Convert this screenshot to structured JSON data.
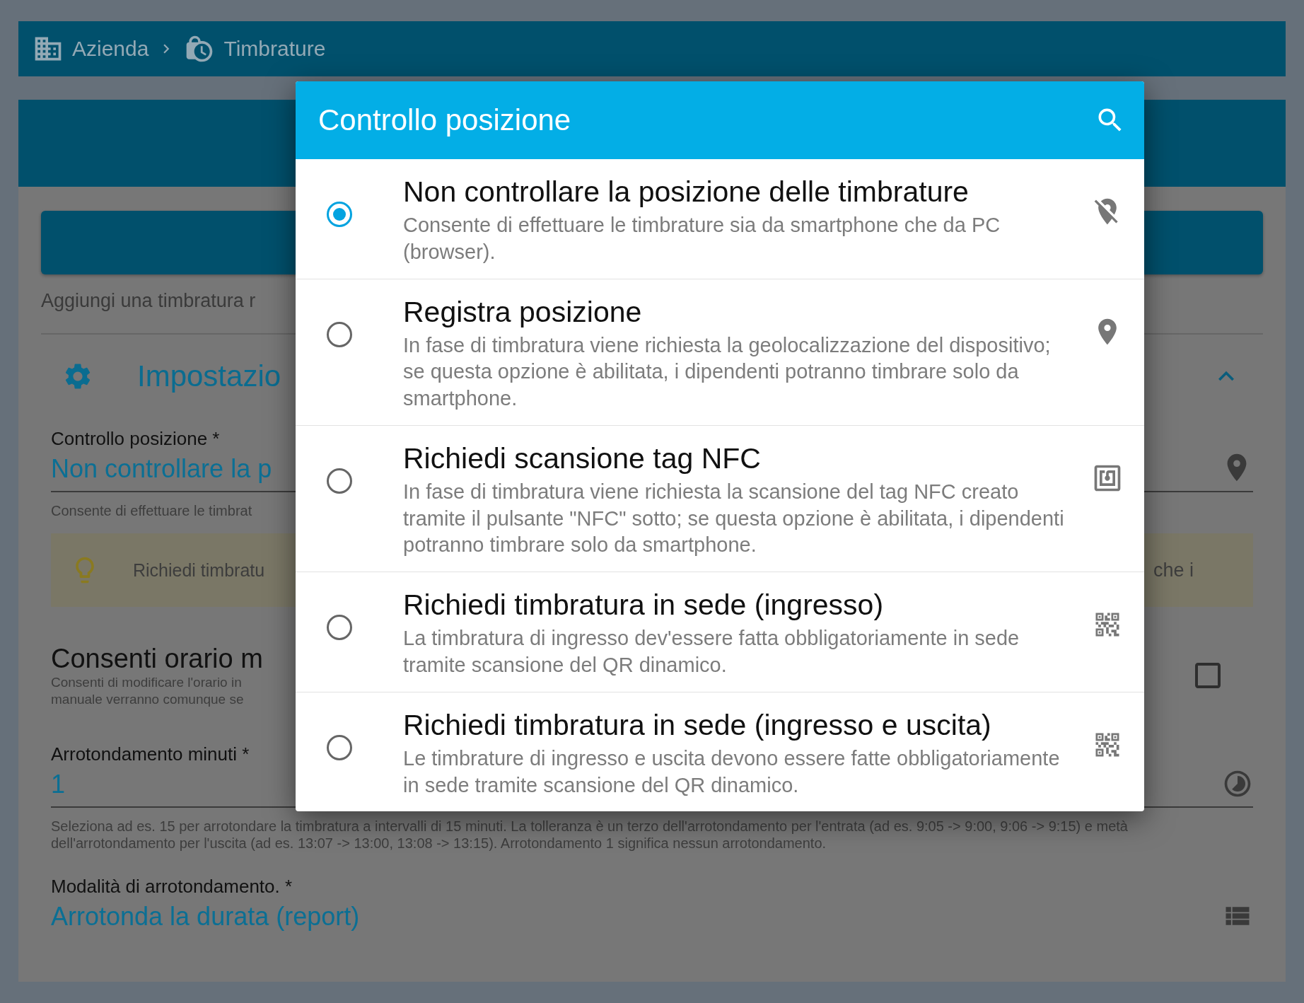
{
  "breadcrumb": [
    {
      "label": "Azienda",
      "kind": "company"
    },
    {
      "label": "Timbrature",
      "kind": "clock"
    }
  ],
  "background": {
    "add_text": "Aggiungi una timbratura r",
    "section_title": "Impostazio",
    "position_field": {
      "label": "Controllo posizione  *",
      "value": "Non controllare la p",
      "help": "Consente di effettuare le timbrat"
    },
    "tip": {
      "text_left": "Richiedi timbratu",
      "text_right": "che i"
    },
    "manual_time": {
      "title": "Consenti orario m",
      "help_lines": [
        "Consenti di modificare l'orario in",
        "manuale verranno comunque se"
      ],
      "checked": false
    },
    "rounding_field": {
      "label": "Arrotondamento minuti  *",
      "value": "1",
      "help": "Seleziona ad es. 15 per arrotondare la timbratura a intervalli di 15 minuti. La tolleranza è un terzo dell'arrotondamento per l'entrata (ad es. 9:05 -> 9:00, 9:06 -> 9:15) e metà dell'arrotondamento per l'uscita (ad es. 13:07 -> 13:00, 13:08 -> 13:15). Arrotondamento 1 significa nessun arrotondamento."
    },
    "rounding_mode_field": {
      "label": "Modalità di arrotondamento.  *",
      "value": "Arrotonda la durata (report)"
    }
  },
  "dialog": {
    "title": "Controllo posizione",
    "options": [
      {
        "title": "Non controllare la posizione delle timbrature",
        "description": "Consente di effettuare le timbrature sia da smartphone che da PC (browser).",
        "kind": "none",
        "selected": true
      },
      {
        "title": "Registra posizione",
        "description": "In fase di timbratura viene richiesta la geolocalizzazione del dispositivo; se questa opzione è abilitata, i dipendenti potranno timbrare solo da smartphone.",
        "kind": "gps",
        "selected": false
      },
      {
        "title": "Richiedi scansione tag NFC",
        "description": "In fase di timbratura viene richiesta la scansione del tag NFC creato tramite il pulsante \"NFC\" sotto; se questa opzione è abilitata, i dipendenti potranno timbrare solo da smartphone.",
        "kind": "nfc",
        "selected": false
      },
      {
        "title": "Richiedi timbratura in sede (ingresso)",
        "description": "La timbratura di ingresso dev'essere fatta obbligatoriamente in sede tramite scansione del QR dinamico.",
        "kind": "qr",
        "selected": false
      },
      {
        "title": "Richiedi timbratura in sede (ingresso e uscita)",
        "description": "Le timbrature di ingresso e uscita devono essere fatte obbligatoriamente in sede tramite scansione del QR dinamico.",
        "kind": "qr",
        "selected": false
      }
    ]
  }
}
